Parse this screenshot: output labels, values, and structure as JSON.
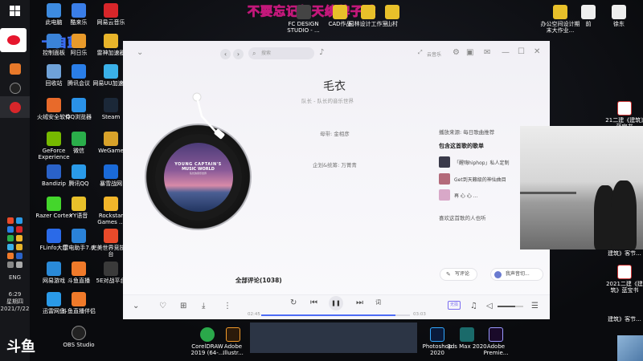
{
  "overlay": {
    "title": "不要忘记每天续牌子哦",
    "streamer_name": "卡自蓝",
    "platform_logo": "斗鱼"
  },
  "taskbar": {
    "time": "6:29",
    "weekday": "星期四",
    "date": "2021/7/22",
    "lang": "ENG"
  },
  "desktop_icons": [
    {
      "label": "此电脑",
      "color": "#3d8be0"
    },
    {
      "label": "酷来乐",
      "color": "#3a7ee8"
    },
    {
      "label": "网易云音乐",
      "color": "#d8262a"
    },
    {
      "label": "控制面板",
      "color": "#3a83d8"
    },
    {
      "label": "阿日乐",
      "color": "#e89a2a"
    },
    {
      "label": "雷神加速器",
      "color": "#e8b42a"
    },
    {
      "label": "回收站",
      "color": "#6fa2d8"
    },
    {
      "label": "腾讯会议",
      "color": "#2a7ee8"
    },
    {
      "label": "网易UU加速器",
      "color": "#3ab0e8"
    },
    {
      "label": "火绒安全软件",
      "color": "#e86a2a"
    },
    {
      "label": "QQ浏览器",
      "color": "#2a92e8"
    },
    {
      "label": "Steam",
      "color": "#1b2838"
    },
    {
      "label": "GeForce Experience",
      "color": "#76b900"
    },
    {
      "label": "微信",
      "color": "#2aae4a"
    },
    {
      "label": "WeGame",
      "color": "#d8a22a"
    },
    {
      "label": "Bandizip",
      "color": "#2a62c8"
    },
    {
      "label": "腾讯QQ",
      "color": "#2a9ae8"
    },
    {
      "label": "暴雪战网",
      "color": "#1a6ad8"
    },
    {
      "label": "Razer Cortex",
      "color": "#44d62c"
    },
    {
      "label": "YY语音",
      "color": "#e8c02a"
    },
    {
      "label": "Rockstar Games ...",
      "color": "#f2b52a"
    },
    {
      "label": "FLinfo大厅",
      "color": "#2a6ae8"
    },
    {
      "label": "雷电助手7.0",
      "color": "#2a82d8"
    },
    {
      "label": "完美世界竞技平台",
      "color": "#e84a2a"
    },
    {
      "label": "网易游戏",
      "color": "#2a8ad8"
    },
    {
      "label": "斗鱼直播",
      "color": "#f07a2a"
    },
    {
      "label": "5E对战平台",
      "color": "#3a3a3a"
    },
    {
      "label": "迅雷网盘",
      "color": "#2a9ae8"
    },
    {
      "label": "斗鱼直播伴侣",
      "color": "#f07a2a"
    },
    {
      "label": "OBS Studio",
      "color": "#222222"
    }
  ],
  "top_icons": {
    "fc_design": "FC DESIGN STUDIO - ...",
    "cad_work": "CAD作品",
    "bottom_work": "园林设计工作室",
    "shan_cun": "山村",
    "office_cn": "办公空间设计期末大作业...",
    "jian": "前",
    "xu_dong": "徐东"
  },
  "right_icons": [
    {
      "label": "21二建《建筑》蓝宝书"
    },
    {
      "label": "建筑》客节..."
    },
    {
      "label": "2021二建《建筑》蓝宝书"
    },
    {
      "label": "建筑》客节..."
    }
  ],
  "bottom_apps": [
    {
      "label": "CorelDRAW 2019 (64-..."
    },
    {
      "label": "Adobe Illustr..."
    },
    {
      "label": "Photoshop 2020"
    },
    {
      "label": "3ds Max 2020"
    },
    {
      "label": "Adobe Premie..."
    }
  ],
  "player": {
    "search_placeholder": "搜索",
    "topbar_right_label": "云音乐",
    "song_title": "毛衣",
    "song_subtitle": "队长 - 队长的音乐世界",
    "credit_1": "母带: 金相彦",
    "credit_2": "企划&统筹: 万菁青",
    "cover_text_1": "YOUNG CAPTAIN'S",
    "cover_text_2": "MUSIC WORLD",
    "cover_text_3": "队长的音乐世界",
    "source_label": "播放来源: 每日歌曲推荐",
    "playlists_header": "包含这首歌的歌单",
    "playlists": [
      {
        "label": "「醒嗨hiphop」私人定制",
        "color": "#3a3a4a"
      },
      {
        "label": "Get到天籁级的神仙曲目",
        "color": "#b36a7a"
      },
      {
        "label": "再 心 心 ...",
        "color": "#d8a8c8"
      }
    ],
    "liked_label": "喜欢这首歌的人也听",
    "comments_title": "全部评论(1038)",
    "write_comment": "写评论",
    "friend_btn": "我声音切...",
    "time_current": "02:45",
    "time_total": "03:03",
    "progress": 0.9,
    "volume": 0.7,
    "hq_badge": "无损",
    "lyric_btn": "词"
  }
}
